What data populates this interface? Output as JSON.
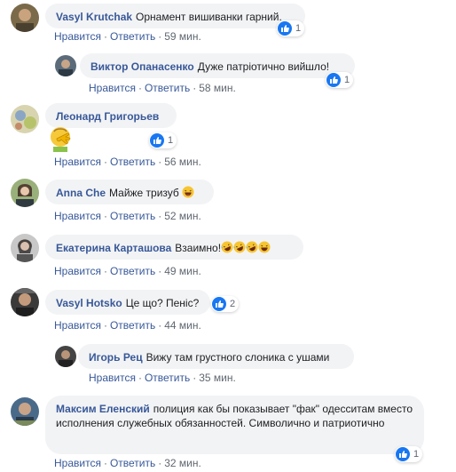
{
  "ui": {
    "like": "Нравится",
    "reply": "Ответить",
    "sep": "·"
  },
  "colors": {
    "author": "#385898",
    "bubble": "#f2f3f5",
    "like_badge": "#1877f2"
  },
  "comments": [
    {
      "author": "Vasyl Krutchak",
      "text": "Орнамент вишиванки гарний.",
      "time": "59 мин.",
      "reactions": "1"
    },
    {
      "author": "Виктор Опанасенко",
      "text": "Дуже патріотично вийшло!",
      "time": "58 мин.",
      "reactions": "1"
    },
    {
      "author": "Леонард Григорьев",
      "text": "",
      "sticker": "face-palm-emoji",
      "time": "56 мин.",
      "reactions": "1"
    },
    {
      "author": "Anna Che",
      "text": "Майже тризуб",
      "emoji": [
        "laughing-emoji"
      ],
      "time": "52 мин."
    },
    {
      "author": "Екатерина Карташова",
      "text": "Взаимно!",
      "emoji": [
        "rofl-emoji",
        "rofl-emoji",
        "rofl-emoji",
        "laughing-emoji"
      ],
      "time": "49 мин."
    },
    {
      "author": "Vasyl Hotsko",
      "text": "Це що? Пеніс?",
      "time": "44 мин.",
      "reactions": "2"
    },
    {
      "author": "Игорь Рец",
      "text": "Вижу там грустного слоника с ушами",
      "time": "35 мин."
    },
    {
      "author": "Максим Еленский",
      "text": "полиция как бы показывает \"фак\" одесситам вместо исполнения служебных обязанностей. Символично и патриотично",
      "time": "32 мин.",
      "reactions": "1"
    }
  ]
}
